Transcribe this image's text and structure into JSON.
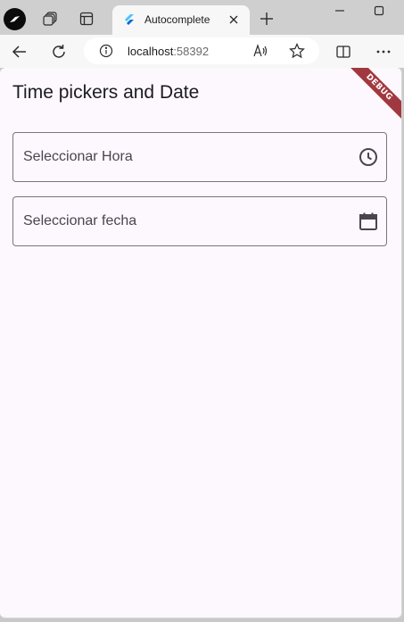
{
  "browser": {
    "tab": {
      "title": "Autocomplete"
    },
    "address": {
      "host": "localhost",
      "port": ":58392"
    }
  },
  "app": {
    "title": "Time pickers and Date",
    "debug_banner": "DEBUG",
    "fields": [
      {
        "label": "Seleccionar Hora",
        "suffix_icon": "clock-icon"
      },
      {
        "label": "Seleccionar fecha",
        "suffix_icon": "calendar-icon"
      }
    ]
  },
  "colors": {
    "page_background": "#fdf8fd",
    "field_border": "#79747e",
    "debug_banner": "#a2383f"
  }
}
